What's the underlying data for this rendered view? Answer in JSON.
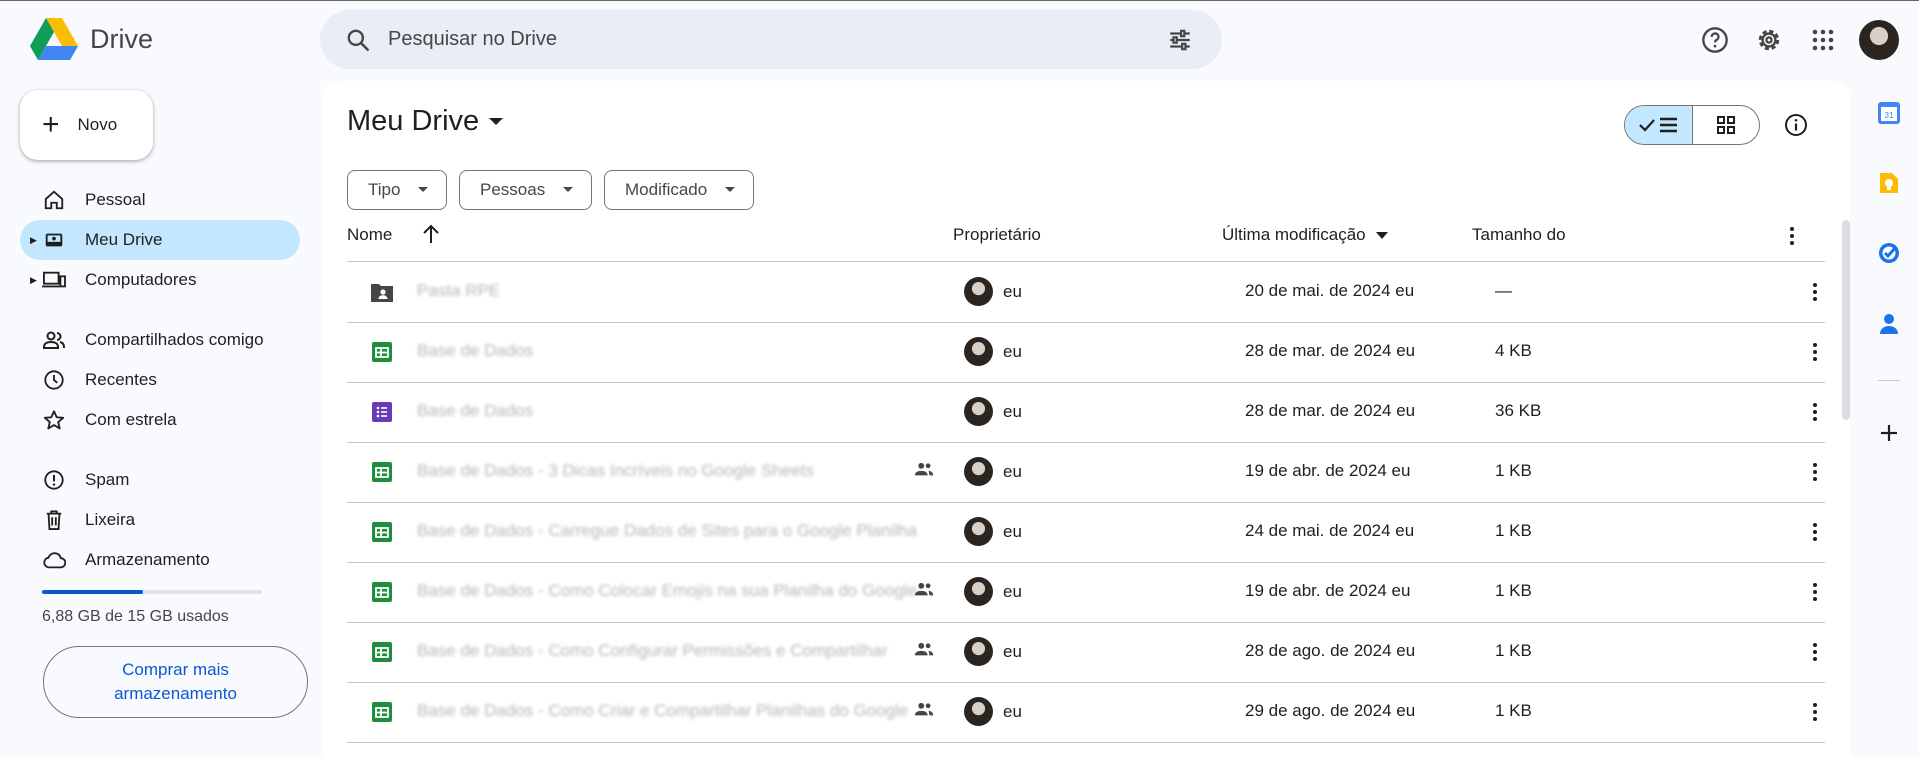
{
  "app": {
    "title": "Drive"
  },
  "search": {
    "placeholder": "Pesquisar no Drive"
  },
  "sidebar": {
    "new_label": "Novo",
    "items": [
      {
        "label": "Pessoal",
        "icon": "home-icon"
      },
      {
        "label": "Meu Drive",
        "icon": "my-drive-icon",
        "active": true
      },
      {
        "label": "Computadores",
        "icon": "computer-icon"
      },
      {
        "label": "Compartilhados comigo",
        "icon": "people-icon"
      },
      {
        "label": "Recentes",
        "icon": "clock-icon"
      },
      {
        "label": "Com estrela",
        "icon": "star-icon"
      },
      {
        "label": "Spam",
        "icon": "spam-icon"
      },
      {
        "label": "Lixeira",
        "icon": "trash-icon"
      },
      {
        "label": "Armazenamento",
        "icon": "cloud-icon"
      }
    ],
    "storage_text": "6,88 GB de 15 GB usados",
    "storage_fraction": 0.4587,
    "buy_label_1": "Comprar mais",
    "buy_label_2": "armazenamento"
  },
  "main": {
    "title": "Meu Drive",
    "filters": [
      "Tipo",
      "Pessoas",
      "Modificado"
    ],
    "columns": {
      "name": "Nome",
      "owner": "Proprietário",
      "modified": "Última modificação",
      "size": "Tamanho do"
    },
    "rows": [
      {
        "name": "Pasta RPE",
        "type": "shared-folder",
        "shared": false,
        "owner": "eu",
        "modified": "20 de mai. de 2024 eu",
        "size": "—"
      },
      {
        "name": "Base de Dados",
        "type": "sheets",
        "shared": false,
        "owner": "eu",
        "modified": "28 de mar. de 2024 eu",
        "size": "4 KB"
      },
      {
        "name": "Base de Dados",
        "type": "forms",
        "shared": false,
        "owner": "eu",
        "modified": "28 de mar. de 2024 eu",
        "size": "36 KB"
      },
      {
        "name": "Base de Dados - 3 Dicas Incríveis no Google Sheets",
        "type": "sheets",
        "shared": true,
        "owner": "eu",
        "modified": "19 de abr. de 2024 eu",
        "size": "1 KB"
      },
      {
        "name": "Base de Dados - Carregue Dados de Sites para o Google Planilhas",
        "type": "sheets",
        "shared": false,
        "owner": "eu",
        "modified": "24 de mai. de 2024 eu",
        "size": "1 KB"
      },
      {
        "name": "Base de Dados - Como Colocar Emojis na sua Planilha do Google",
        "type": "sheets",
        "shared": true,
        "owner": "eu",
        "modified": "19 de abr. de 2024 eu",
        "size": "1 KB"
      },
      {
        "name": "Base de Dados - Como Configurar Permissões e Compartilhar",
        "type": "sheets",
        "shared": true,
        "owner": "eu",
        "modified": "28 de ago. de 2024 eu",
        "size": "1 KB"
      },
      {
        "name": "Base de Dados - Como Criar e Compartilhar Planilhas do Google",
        "type": "sheets",
        "shared": true,
        "owner": "eu",
        "modified": "29 de ago. de 2024 eu",
        "size": "1 KB"
      }
    ]
  },
  "colors": {
    "accent": "#0b57d0",
    "active_bg": "#c2e7ff",
    "sheets": "#1e8e3e",
    "forms": "#673ab7"
  }
}
